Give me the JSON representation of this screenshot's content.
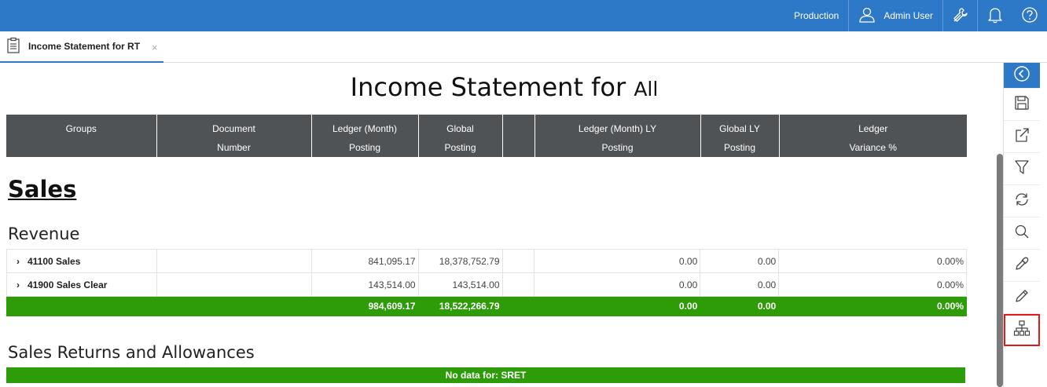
{
  "topbar": {
    "environment": "Production",
    "user": "Admin User",
    "icons": [
      "user-icon",
      "wrench-icon",
      "bell-icon",
      "help-icon"
    ]
  },
  "tab": {
    "title": "Income Statement for RT",
    "icon": "clipboard-icon",
    "close": "×"
  },
  "report": {
    "title": "Income Statement for",
    "scope": "All",
    "columns": [
      [
        "Groups",
        ""
      ],
      [
        "Document",
        "Number"
      ],
      [
        "Ledger (Month)",
        "Posting"
      ],
      [
        "Global",
        "Posting"
      ],
      [
        "",
        ""
      ],
      [
        "Ledger (Month) LY",
        "Posting"
      ],
      [
        "Global LY",
        "Posting"
      ],
      [
        "Ledger",
        "Variance %"
      ]
    ]
  },
  "section": "Sales",
  "groups": {
    "revenue": {
      "title": "Revenue",
      "rows": [
        {
          "label": "41100 Sales",
          "doc": "",
          "ledger": "841,095.17",
          "global": "18,378,752.79",
          "blank": "",
          "ledger_ly": "0.00",
          "global_ly": "0.00",
          "variance": "0.00%"
        },
        {
          "label": "41900 Sales Clear",
          "doc": "",
          "ledger": "143,514.00",
          "global": "143,514.00",
          "blank": "",
          "ledger_ly": "0.00",
          "global_ly": "0.00",
          "variance": "0.00%"
        }
      ],
      "total": {
        "ledger": "984,609.17",
        "global": "18,522,266.79",
        "ledger_ly": "0.00",
        "global_ly": "0.00",
        "variance": "0.00%"
      }
    },
    "returns": {
      "title": "Sales Returns and Allowances",
      "nodata": "No data for: SRET"
    }
  },
  "sidebar": {
    "buttons": [
      "back-icon",
      "save-icon",
      "share-icon",
      "filter-icon",
      "refresh-icon",
      "search-icon",
      "eyedropper-icon",
      "pencil-icon",
      "hierarchy-icon"
    ]
  },
  "colors": {
    "brand_blue": "#2e78c8",
    "header_gray": "#505356",
    "total_green": "#2e9c08",
    "highlight_red": "#e01b1b"
  }
}
